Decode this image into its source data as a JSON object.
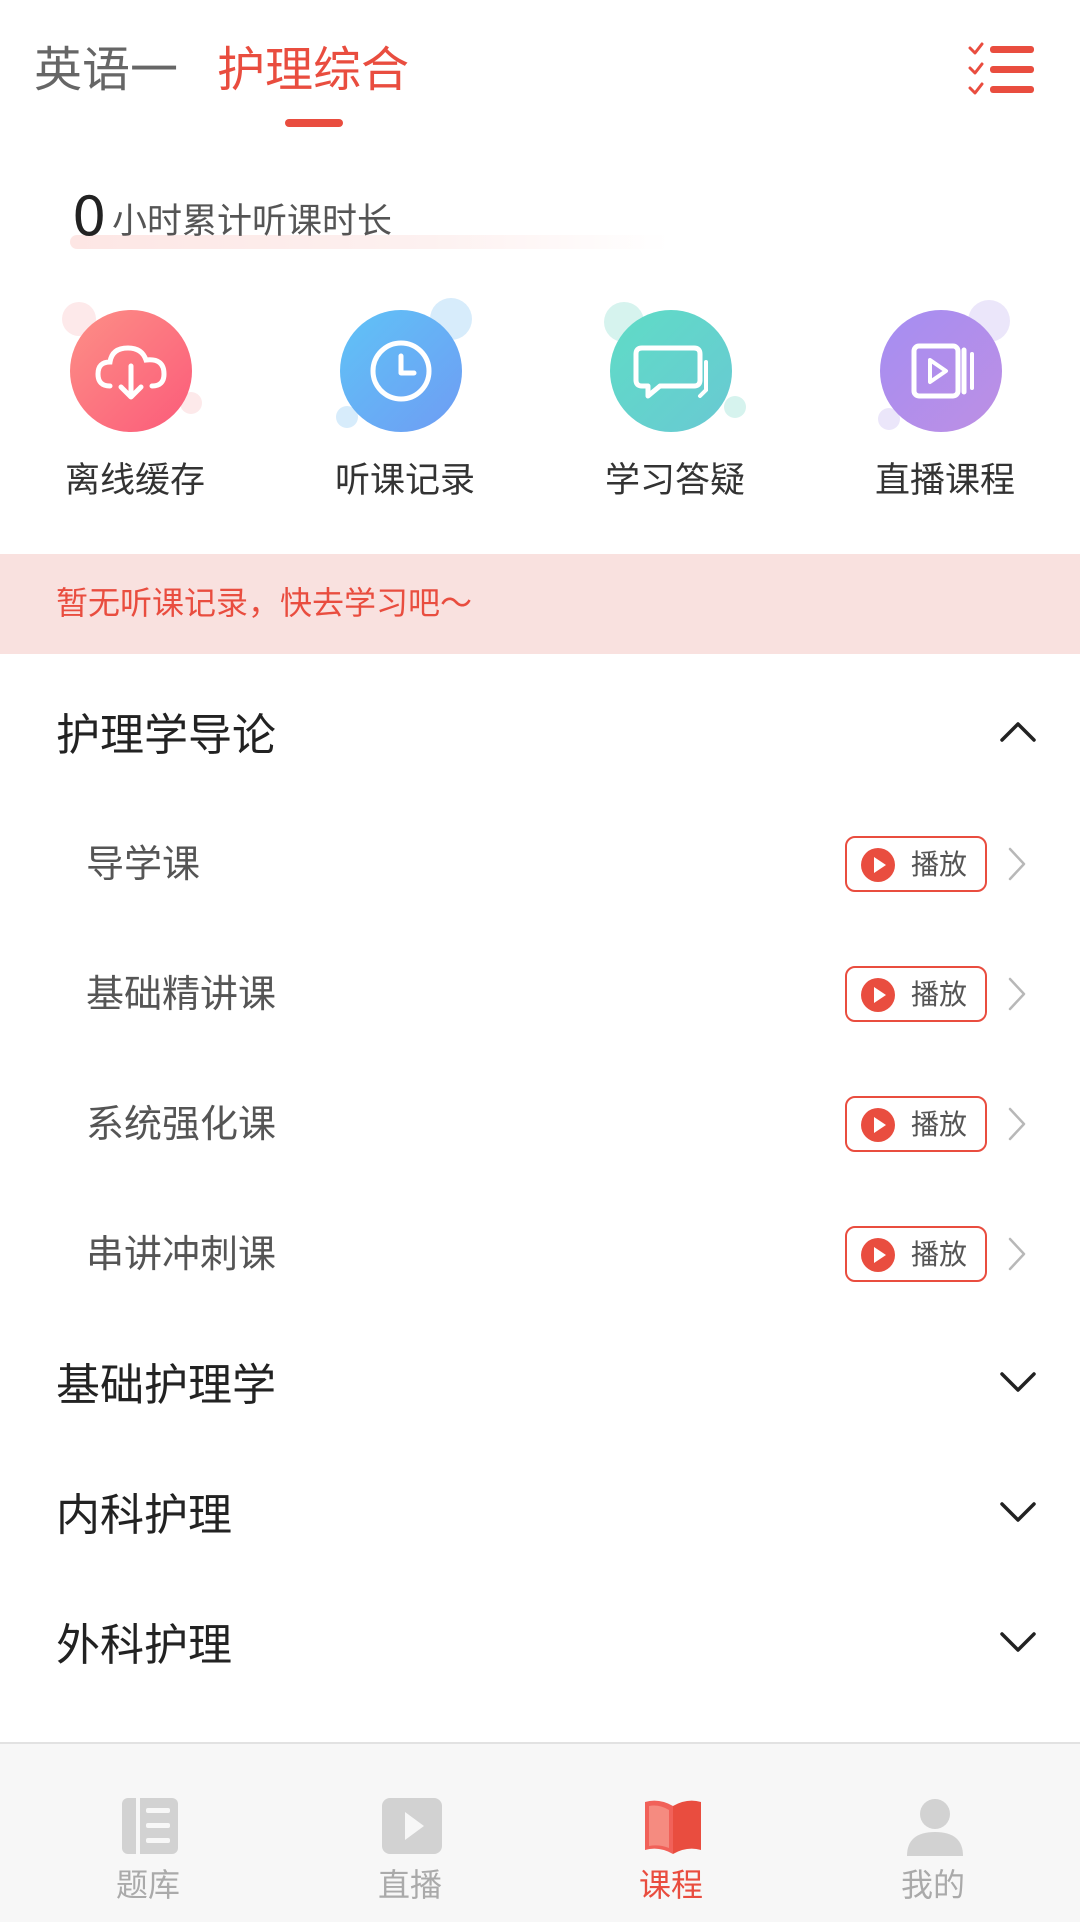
{
  "top_tabs": [
    {
      "label": "英语一",
      "active": false
    },
    {
      "label": "护理综合",
      "active": true
    }
  ],
  "stats": {
    "hours": "0",
    "label": "小时累计听课时长"
  },
  "quick_actions": [
    {
      "label": "离线缓存",
      "icon": "cloud-download-icon"
    },
    {
      "label": "听课记录",
      "icon": "clock-icon"
    },
    {
      "label": "学习答疑",
      "icon": "chat-bubbles-icon"
    },
    {
      "label": "直播课程",
      "icon": "video-play-icon"
    }
  ],
  "banner": {
    "text": "暂无听课记录，快去学习吧～"
  },
  "sections": [
    {
      "title": "护理学导论",
      "expanded": true,
      "lessons": [
        {
          "title": "导学课",
          "action": "播放"
        },
        {
          "title": "基础精讲课",
          "action": "播放"
        },
        {
          "title": "系统强化课",
          "action": "播放"
        },
        {
          "title": "串讲冲刺课",
          "action": "播放"
        }
      ]
    },
    {
      "title": "基础护理学",
      "expanded": false
    },
    {
      "title": "内科护理",
      "expanded": false
    },
    {
      "title": "外科护理",
      "expanded": false
    }
  ],
  "bottom_nav": [
    {
      "label": "题库",
      "icon": "question-bank-icon",
      "active": false
    },
    {
      "label": "直播",
      "icon": "live-play-icon",
      "active": false
    },
    {
      "label": "课程",
      "icon": "open-book-icon",
      "active": true
    },
    {
      "label": "我的",
      "icon": "user-icon",
      "active": false
    }
  ],
  "colors": {
    "accent": "#e94d3f",
    "banner_bg": "#f9e1df",
    "text_dark": "#222222",
    "text_gray": "#555555",
    "nav_inactive": "#aaaaaa"
  }
}
